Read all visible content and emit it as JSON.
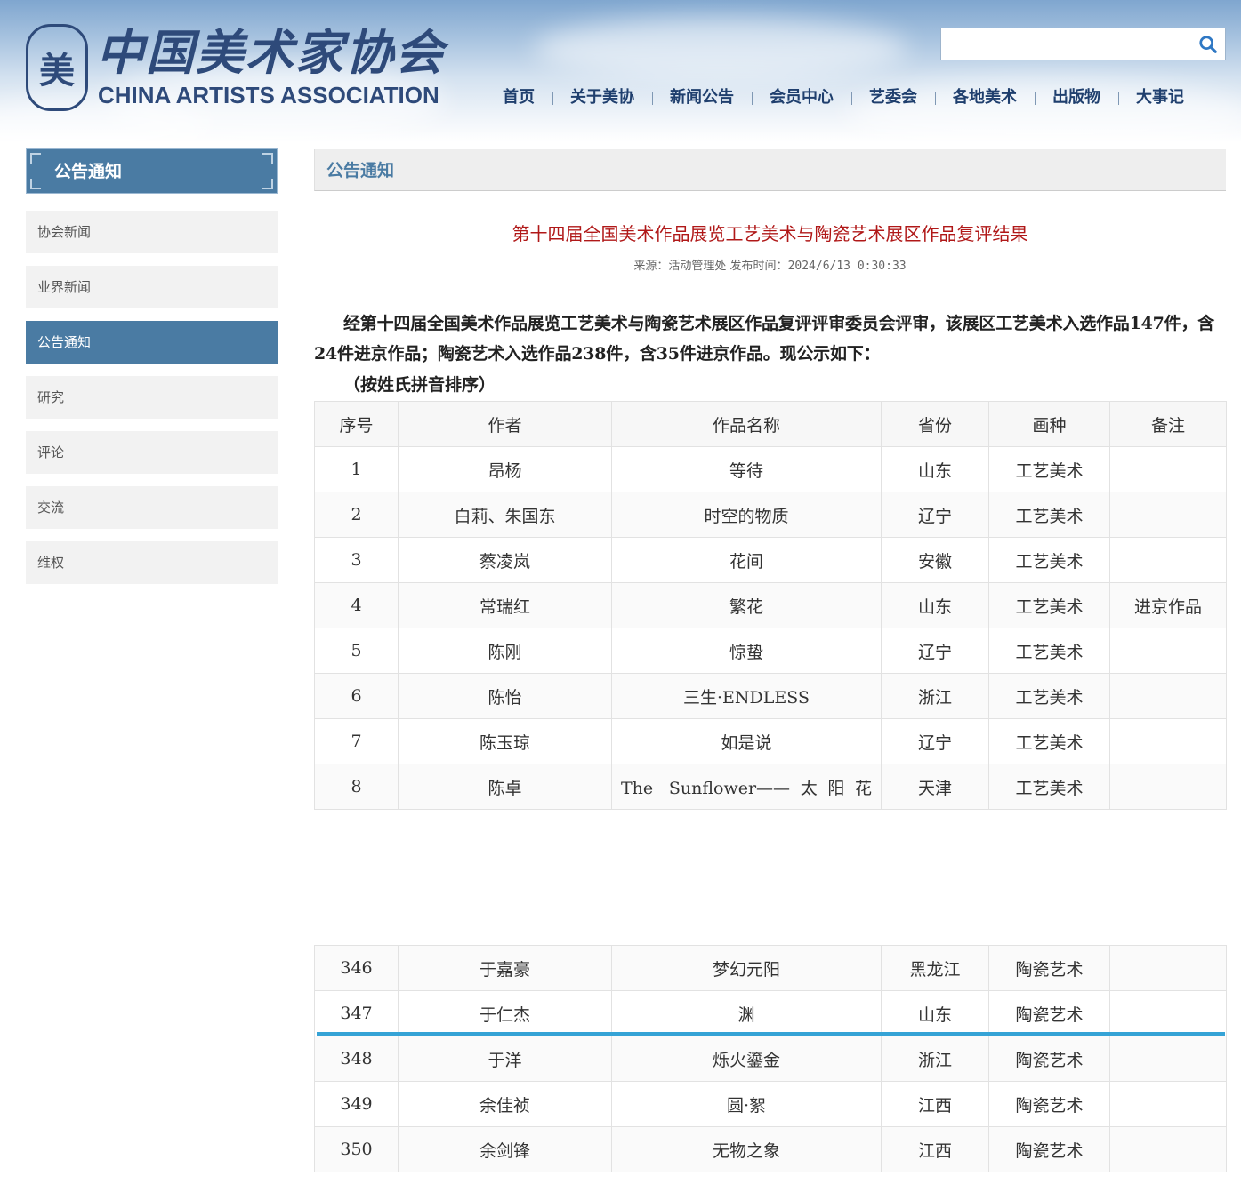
{
  "header": {
    "logo_mark": "美",
    "logo_cn": "中国美术家协会",
    "logo_en": "CHINA ARTISTS ASSOCIATION",
    "search": {
      "value": "",
      "placeholder": ""
    },
    "nav": [
      "首页",
      "关于美协",
      "新闻公告",
      "会员中心",
      "艺委会",
      "各地美术",
      "出版物",
      "大事记"
    ]
  },
  "sidebar": {
    "title": "公告通知",
    "items": [
      {
        "label": "协会新闻",
        "active": false
      },
      {
        "label": "业界新闻",
        "active": false
      },
      {
        "label": "公告通知",
        "active": true
      },
      {
        "label": "研究",
        "active": false
      },
      {
        "label": "评论",
        "active": false
      },
      {
        "label": "交流",
        "active": false
      },
      {
        "label": "维权",
        "active": false
      }
    ]
  },
  "main": {
    "section_title": "公告通知",
    "article": {
      "title": "第十四届全国美术作品展览工艺美术与陶瓷艺术展区作品复评结果",
      "source_label": "来源：",
      "source": "活动管理处",
      "date_label": "发布时间：",
      "date": "2024/6/13 0:30:33",
      "intro": "经第十四届全国美术作品展览工艺美术与陶瓷艺术展区作品复评评审委员会评审，该展区工艺美术入选作品147件，含24件进京作品；陶瓷艺术入选作品238件，含35件进京作品。现公示如下：",
      "sort_note": "（按姓氏拼音排序）"
    },
    "table": {
      "headers": [
        "序号",
        "作者",
        "作品名称",
        "省份",
        "画种",
        "备注"
      ],
      "rows_top": [
        [
          "1",
          "昂杨",
          "等待",
          "山东",
          "工艺美术",
          ""
        ],
        [
          "2",
          "白莉、朱国东",
          "时空的物质",
          "辽宁",
          "工艺美术",
          ""
        ],
        [
          "3",
          "蔡凌岚",
          "花间",
          "安徽",
          "工艺美术",
          ""
        ],
        [
          "4",
          "常瑞红",
          "繁花",
          "山东",
          "工艺美术",
          "进京作品"
        ],
        [
          "5",
          "陈刚",
          "惊蛰",
          "辽宁",
          "工艺美术",
          ""
        ],
        [
          "6",
          "陈怡",
          "三生·ENDLESS",
          "浙江",
          "工艺美术",
          ""
        ],
        [
          "7",
          "陈玉琼",
          "如是说",
          "辽宁",
          "工艺美术",
          ""
        ],
        [
          "8",
          "陈卓",
          "The Sunflower——太阳花",
          "天津",
          "工艺美术",
          ""
        ]
      ],
      "rows_bottom": [
        [
          "346",
          "于嘉豪",
          "梦幻元阳",
          "黑龙江",
          "陶瓷艺术",
          ""
        ],
        [
          "347",
          "于仁杰",
          "渊",
          "山东",
          "陶瓷艺术",
          ""
        ],
        [
          "348",
          "于洋",
          "烁火鎏金",
          "浙江",
          "陶瓷艺术",
          ""
        ],
        [
          "349",
          "余佳祯",
          "圆·絮",
          "江西",
          "陶瓷艺术",
          ""
        ],
        [
          "350",
          "余剑锋",
          "无物之象",
          "江西",
          "陶瓷艺术",
          ""
        ]
      ]
    }
  },
  "colors": {
    "brand_blue": "#4a7ba3",
    "title_red": "#b01818",
    "nav_text": "#1f3f6e",
    "highlight_line": "#35a3d6"
  }
}
